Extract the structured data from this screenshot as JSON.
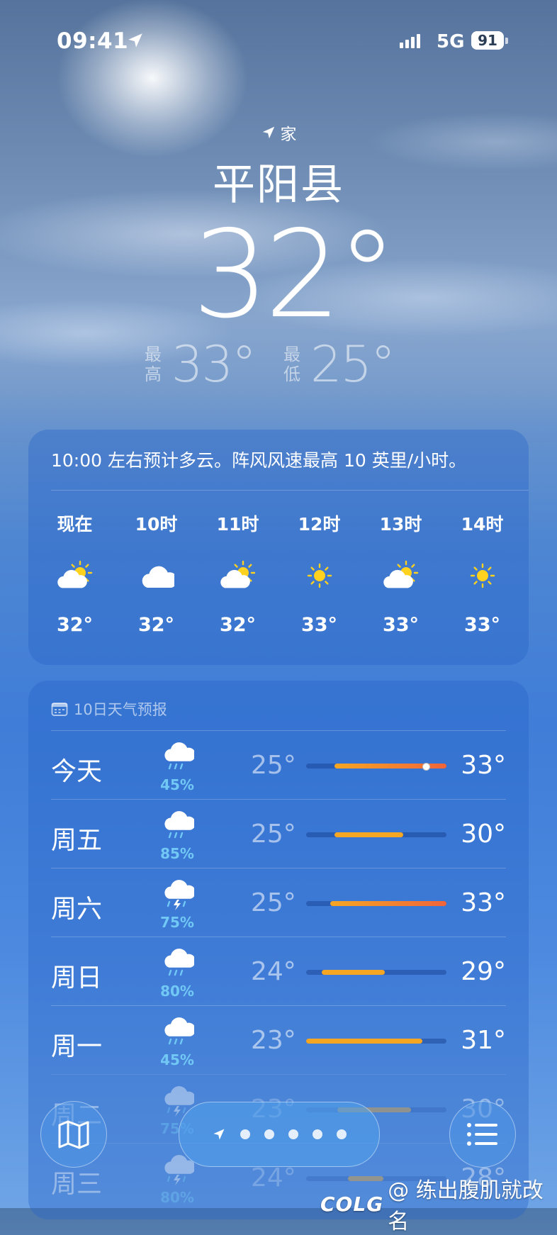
{
  "status": {
    "time": "09:41",
    "network": "5G",
    "battery": "91"
  },
  "header": {
    "location_tag": "家",
    "city": "平阳县",
    "temperature": "32°",
    "high_label": "最\n高",
    "high_label_1": "最",
    "high_label_2": "高",
    "high": "33°",
    "low_label_1": "最",
    "low_label_2": "低",
    "low": "25°"
  },
  "hourly": {
    "summary": "10:00 左右预计多云。阵风风速最高 10 英里/小时。",
    "hours": [
      {
        "label": "现在",
        "icon": "partly-sunny-icon",
        "temp": "32°"
      },
      {
        "label": "10时",
        "icon": "cloud-icon",
        "temp": "32°"
      },
      {
        "label": "11时",
        "icon": "partly-sunny-icon",
        "temp": "32°"
      },
      {
        "label": "12时",
        "icon": "sun-icon",
        "temp": "33°"
      },
      {
        "label": "13时",
        "icon": "partly-sunny-icon",
        "temp": "33°"
      },
      {
        "label": "14时",
        "icon": "sun-icon",
        "temp": "33°"
      }
    ]
  },
  "daily": {
    "title": "10日天气预报",
    "days": [
      {
        "day": "今天",
        "icon": "rain-icon",
        "precip": "45%",
        "low": "25°",
        "high": "33°",
        "range_start": 0.2,
        "range_end": 1.0,
        "current": 0.85
      },
      {
        "day": "周五",
        "icon": "rain-icon",
        "precip": "85%",
        "low": "25°",
        "high": "30°",
        "range_start": 0.2,
        "range_end": 0.69
      },
      {
        "day": "周六",
        "icon": "thunderstorm-icon",
        "precip": "75%",
        "low": "25°",
        "high": "33°",
        "range_start": 0.17,
        "range_end": 1.0
      },
      {
        "day": "周日",
        "icon": "rain-icon",
        "precip": "80%",
        "low": "24°",
        "high": "29°",
        "range_start": 0.11,
        "range_end": 0.56
      },
      {
        "day": "周一",
        "icon": "rain-icon",
        "precip": "45%",
        "low": "23°",
        "high": "31°",
        "range_start": 0.0,
        "range_end": 0.83
      },
      {
        "day": "周二",
        "icon": "thunderstorm-icon",
        "precip": "75%",
        "low": "23°",
        "high": "30°",
        "range_start": 0.22,
        "range_end": 0.75
      },
      {
        "day": "周三",
        "icon": "thunderstorm-icon",
        "precip": "80%",
        "low": "24°",
        "high": "28°",
        "range_start": 0.3,
        "range_end": 0.55
      }
    ]
  },
  "watermark": {
    "logo": "COLG",
    "text": "@ 练出腹肌就改名"
  },
  "colors": {
    "bar_warm": "#f5a623",
    "bar_hot": "#f0653a",
    "precip": "#71c8f5"
  }
}
